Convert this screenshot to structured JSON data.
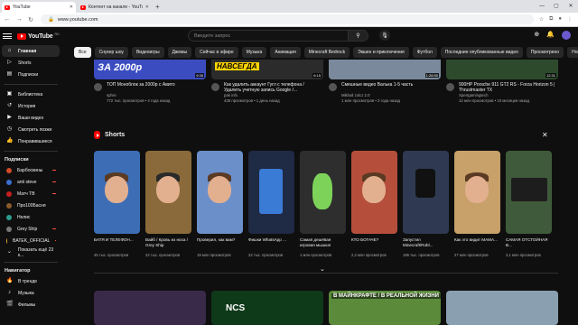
{
  "browser": {
    "tabs": [
      {
        "label": "YouTube",
        "active": true
      },
      {
        "label": "Контент на канале - YouTube Stu...",
        "active": false
      }
    ],
    "url": "www.youtube.com",
    "new_tab": "+"
  },
  "header": {
    "logo_text": "YouTube",
    "logo_region": "RU",
    "search_placeholder": "Введите запрос"
  },
  "sidebar": {
    "main": [
      {
        "label": "Главная",
        "icon": "home-icon",
        "selected": true
      },
      {
        "label": "Shorts",
        "icon": "shorts-icon",
        "selected": false
      },
      {
        "label": "Подписки",
        "icon": "subscriptions-icon",
        "selected": false
      }
    ],
    "library": [
      {
        "label": "Библиотека",
        "icon": "library-icon"
      },
      {
        "label": "История",
        "icon": "history-icon"
      },
      {
        "label": "Ваши видео",
        "icon": "your-videos-icon"
      },
      {
        "label": "Смотреть позже",
        "icon": "watch-later-icon"
      },
      {
        "label": "Понравившиеся",
        "icon": "liked-icon"
      }
    ],
    "subscriptions_heading": "Подписки",
    "subscriptions": [
      {
        "label": "Барбоскины",
        "color": "#d24b2a",
        "live": true
      },
      {
        "label": "anti steve",
        "color": "#3c6fd1",
        "live": true
      },
      {
        "label": "Матч ТВ",
        "color": "#c81e1e",
        "live": true
      },
      {
        "label": "Про100Басня",
        "color": "#8b5a2b",
        "live": false
      },
      {
        "label": "Нелис",
        "color": "#2a9d8f",
        "live": false
      },
      {
        "label": "Grey Ship",
        "color": "#777777",
        "live": true
      },
      {
        "label": "BATEK_OFFICIAL",
        "color": "#e0a030",
        "live": true
      }
    ],
    "show_more": "Показать ещё 23 к...",
    "navigator_heading": "Навигатор",
    "navigator": [
      {
        "label": "В тренде",
        "icon": "trending-icon"
      },
      {
        "label": "Музыка",
        "icon": "music-icon"
      },
      {
        "label": "Фильмы",
        "icon": "movies-icon"
      }
    ]
  },
  "chips": [
    "Все",
    "Снукер шоу",
    "Видеоигры",
    "Джемы",
    "Сейчас в эфире",
    "Музыка",
    "Анимация",
    "Minecraft Bedrock",
    "Экшен и приключения",
    "Футбол",
    "Последние опубликованные видео",
    "Просмотрено",
    "Новое для вас"
  ],
  "videos": [
    {
      "thumb_text": "ЗА 2000р",
      "duration": "9:35",
      "title": "ТОП Моноблок за 2000р с Авито",
      "channel": "sphre",
      "meta": "772 тыс. просмотров • 4 года назад",
      "bg": "#3b4cc0"
    },
    {
      "thumb_text": "НАВСЕГДА",
      "duration": "6:15",
      "title": "Как удалить аккаунт Гугл с телефона / Удалить учетную запись Google /...",
      "channel": "pak info",
      "meta": "435 просмотров • 1 день назад",
      "bg": "#2b2b2b"
    },
    {
      "thumb_text": "",
      "duration": "1:26:50",
      "title": "Смешные видео Валька 1-5 часть",
      "channel": "Mikhail zolcz 2.0",
      "meta": "1 млн просмотров • 3 года назад",
      "bg": "#7a8a9c"
    },
    {
      "thumb_text": "",
      "duration": "12:31",
      "title": "900HP Porsche 911 GT2 RS - Forza Horizon 5 | Thrustmaster TX",
      "channel": "Xpertgamingtech",
      "meta": "12 млн просмотров • 10 месяцев назад",
      "bg": "#2d4a2d"
    }
  ],
  "shorts_heading": "Shorts",
  "shorts": [
    {
      "title": "БАТЯ И ТЕЛЕФОН...",
      "views": "45 тыс. просмотров",
      "bg": "#3d6db5"
    },
    {
      "title": "Вайб / Кровь из носа / Grey Ship",
      "views": "22 тыс. просмотров",
      "bg": "#8a6a3a"
    },
    {
      "title": "Проверил, как вам?",
      "views": "19 млн просмотров",
      "bg": "#6b8fc9"
    },
    {
      "title": "Фишки WhatsApp ...",
      "views": "22 тыс. просмотров",
      "bg": "#1f2a44"
    },
    {
      "title": "Самая дешёвая игровая мышка!",
      "views": "1 млн просмотров",
      "bg": "#2e2e2e"
    },
    {
      "title": "КТО БОГАЧЕ?",
      "views": "2,2 млн просмотров",
      "bg": "#b54f3c"
    },
    {
      "title": "Запустил Minecraft/Robl...",
      "views": "186 тыс. просмотров",
      "bg": "#2f3a52"
    },
    {
      "title": "Как это видит МАМА...",
      "views": "27 млн просмотров",
      "bg": "#c7a06a"
    },
    {
      "title": "САМАЯ ОТСТОЙНАЯ В...",
      "views": "3,1 млн просмотров",
      "bg": "#3f5a3a"
    }
  ],
  "bottom_videos": [
    {
      "label": "",
      "bg": "#3a2a4a"
    },
    {
      "label": "NCS",
      "bg": "#0f3a1a"
    },
    {
      "label": "В МАЙНКРАФТЕ / В РЕАЛЬНОЙ ЖИЗНИ",
      "bg": "#5a8a3a"
    },
    {
      "label": "",
      "bg": "#8aa0b0"
    }
  ]
}
